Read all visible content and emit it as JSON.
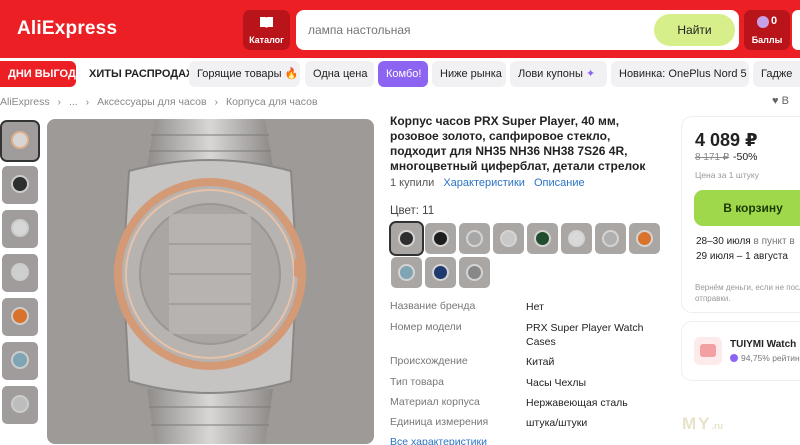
{
  "header": {
    "logo": "AliExpress",
    "catalog_label": "Каталог",
    "search_placeholder": "лампа настольная",
    "search_button": "Найти",
    "points_count": "0",
    "points_label": "Баллы"
  },
  "nav": {
    "chips": [
      "ДНИ ВЫГОДЫ",
      "ХИТЫ РАСПРОДАЖИ",
      "Горящие товары",
      "Одна цена",
      "Комбо!",
      "Ниже рынка",
      "Лови купоны",
      "Новинка: OnePlus Nord 5",
      "Гадже"
    ]
  },
  "breadcrumb": {
    "items": [
      "AliExpress",
      "...",
      "Аксессуары для часов",
      "Корпуса для часов"
    ],
    "separator": "›",
    "wishlist": "В"
  },
  "product": {
    "title": "Корпус часов PRX Super Player, 40 мм, розовое золото, сапфировое стекло, подходит для NH35 NH36 NH38 7S26 4R, многоцветный циферблат, детали стрелок",
    "bought": "1 купили",
    "characteristics_link": "Характеристики",
    "description_link": "Описание",
    "color_label": "Цвет: 11",
    "swatch_dial_colors": [
      "#2e2e2e",
      "#1e1e1e",
      "#a7a7a7",
      "#c8c8c8",
      "#1f4d2e",
      "#d9d9d9",
      "#b0b0b0",
      "#d9722a",
      "#7fa4b4",
      "#1e3a6e",
      "#888888"
    ],
    "specs": [
      {
        "key": "Название бренда",
        "value": "Нет"
      },
      {
        "key": "Номер модели",
        "value": "PRX Super Player Watch Cases"
      },
      {
        "key": "Происхождение",
        "value": "Китай"
      },
      {
        "key": "Тип товара",
        "value": "Часы Чехлы"
      },
      {
        "key": "Материал корпуса",
        "value": "Нержавеющая сталь"
      },
      {
        "key": "Единица измерения",
        "value": "штука/штуки"
      }
    ],
    "all_characteristics": "Все характеристики"
  },
  "buy": {
    "price": "4 089 ₽",
    "old_price": "8 171 ₽",
    "discount": "-50%",
    "per_unit": "Цена за 1 штуку",
    "cart_button": "В корзину",
    "shipping1_date": "28–30 июля",
    "shipping1_note": "в пункт в",
    "shipping2": "29 июля – 1 августа",
    "refund_note": "Вернём деньги, если не после отправки."
  },
  "seller": {
    "name": "TUIYMI Watch",
    "rating": "94,75% рейтинг"
  },
  "watermark": {
    "text": "MY",
    "suffix": ".ru"
  },
  "colors": {
    "brand_red": "#ec1f24",
    "search_button": "#d6ef8a",
    "cart_button": "#9fd84b",
    "link_blue": "#2a73c4",
    "combo_purple": "#8d64f2"
  }
}
